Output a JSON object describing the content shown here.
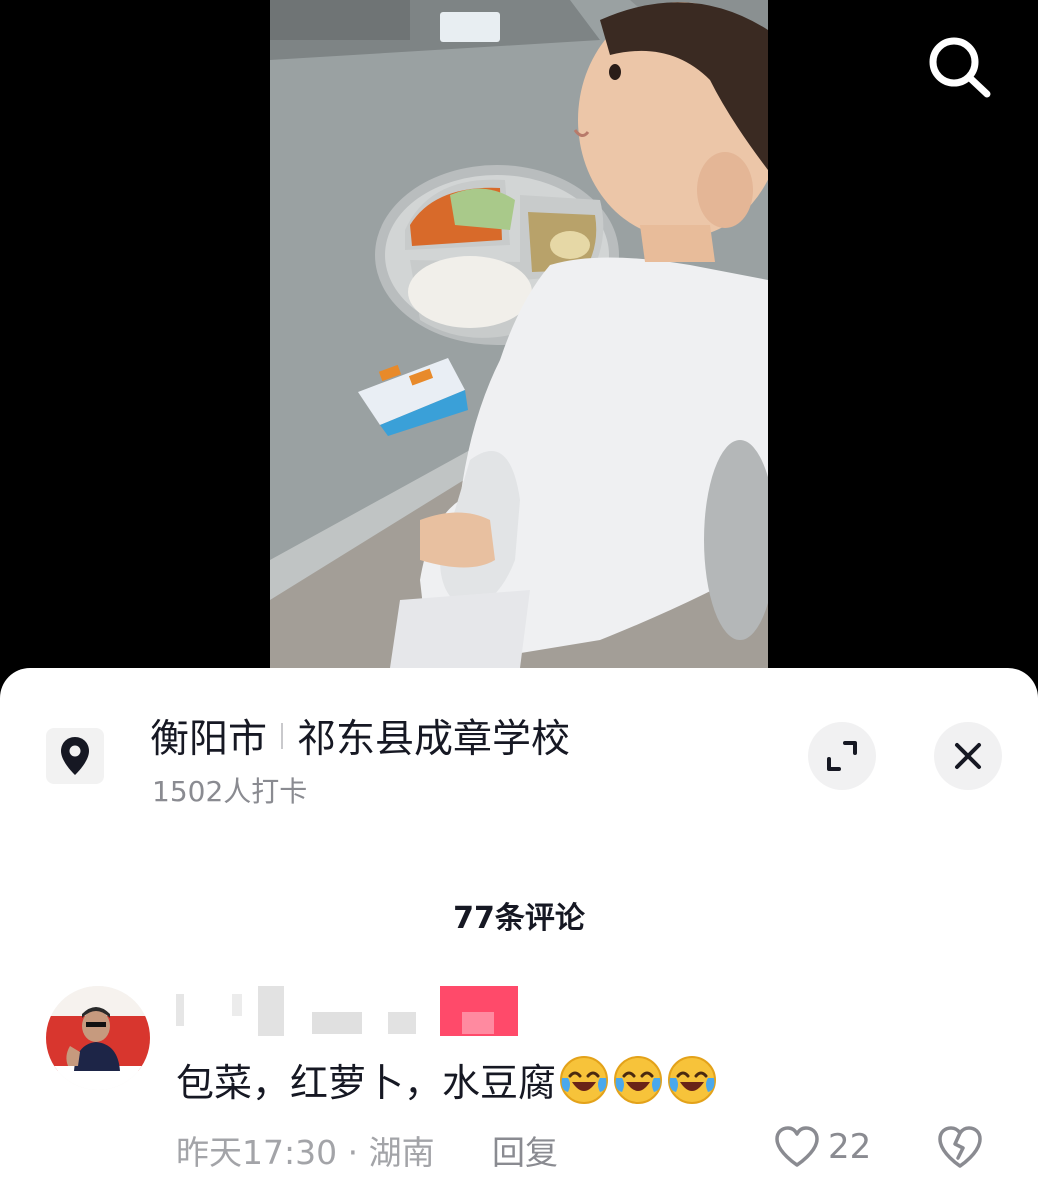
{
  "location": {
    "city": "衡阳市",
    "place": "祁东县成章学校",
    "checkins": "1502人打卡"
  },
  "comments_header": {
    "count_label": "77条评论"
  },
  "comment": {
    "text": "包菜，红萝卜，水豆腐",
    "emoji": [
      "crying-laughing-emoji",
      "crying-laughing-emoji",
      "crying-laughing-emoji"
    ],
    "time_location": "昨天17:30 · 湖南",
    "reply_label": "回复",
    "like_count": "22"
  },
  "icons": {
    "search": "search-icon",
    "location": "location-pin-icon",
    "expand": "expand-icon",
    "close": "close-icon",
    "like": "heart-icon",
    "dislike": "broken-heart-icon"
  }
}
